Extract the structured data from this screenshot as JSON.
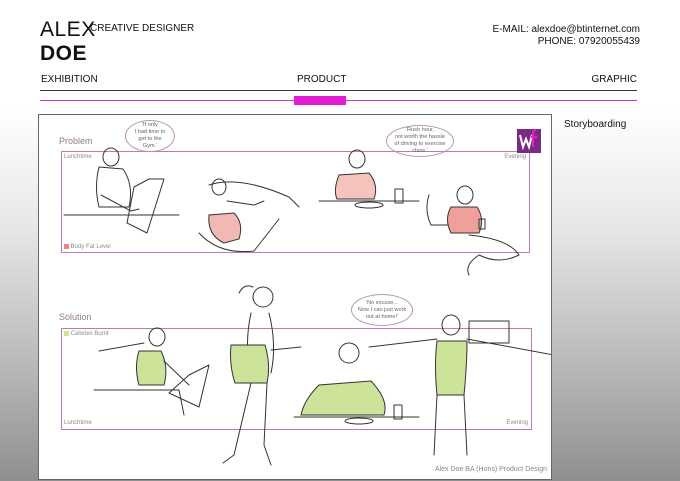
{
  "header": {
    "first_name": "ALEX",
    "last_name": "DOE",
    "role": "CREATIVE DESIGNER",
    "email": "E-MAIL: alexdoe@btinternet.com",
    "phone": "PHONE: 07920055439"
  },
  "nav": {
    "items": [
      "EXHIBITION",
      "PRODUCT",
      "GRAPHIC"
    ],
    "active_index": 1,
    "accent_color": "#e21cd3"
  },
  "section_caption": "Storyboarding",
  "storyboard": {
    "problem_heading": "Problem",
    "solution_heading": "Solution",
    "problem_lunchtime": "Lunchtime",
    "problem_evening": "Evening",
    "problem_legend": "Body Fat Level",
    "solution_legend": "Calories Burnt",
    "solution_lunchtime": "Lunchtime",
    "solution_evening": "Evening",
    "bubble_1": "'If only\nI had time to\nget to the\nGym.'",
    "bubble_2": "'Rush hour,\nnot worth the hassle\nof driving to exercise\nclass.'",
    "bubble_3": "'No excuse...\nNow I can just work\nout at home!'",
    "credit": "Alex Doe BA (Hons) Product Design",
    "colors": {
      "panel_border": "#b77fb1",
      "body_fat_red": "#e98585",
      "calories_green": "#cde39a",
      "logo_purple": "#7a2a82",
      "logo_pink": "#e21cd3"
    }
  }
}
